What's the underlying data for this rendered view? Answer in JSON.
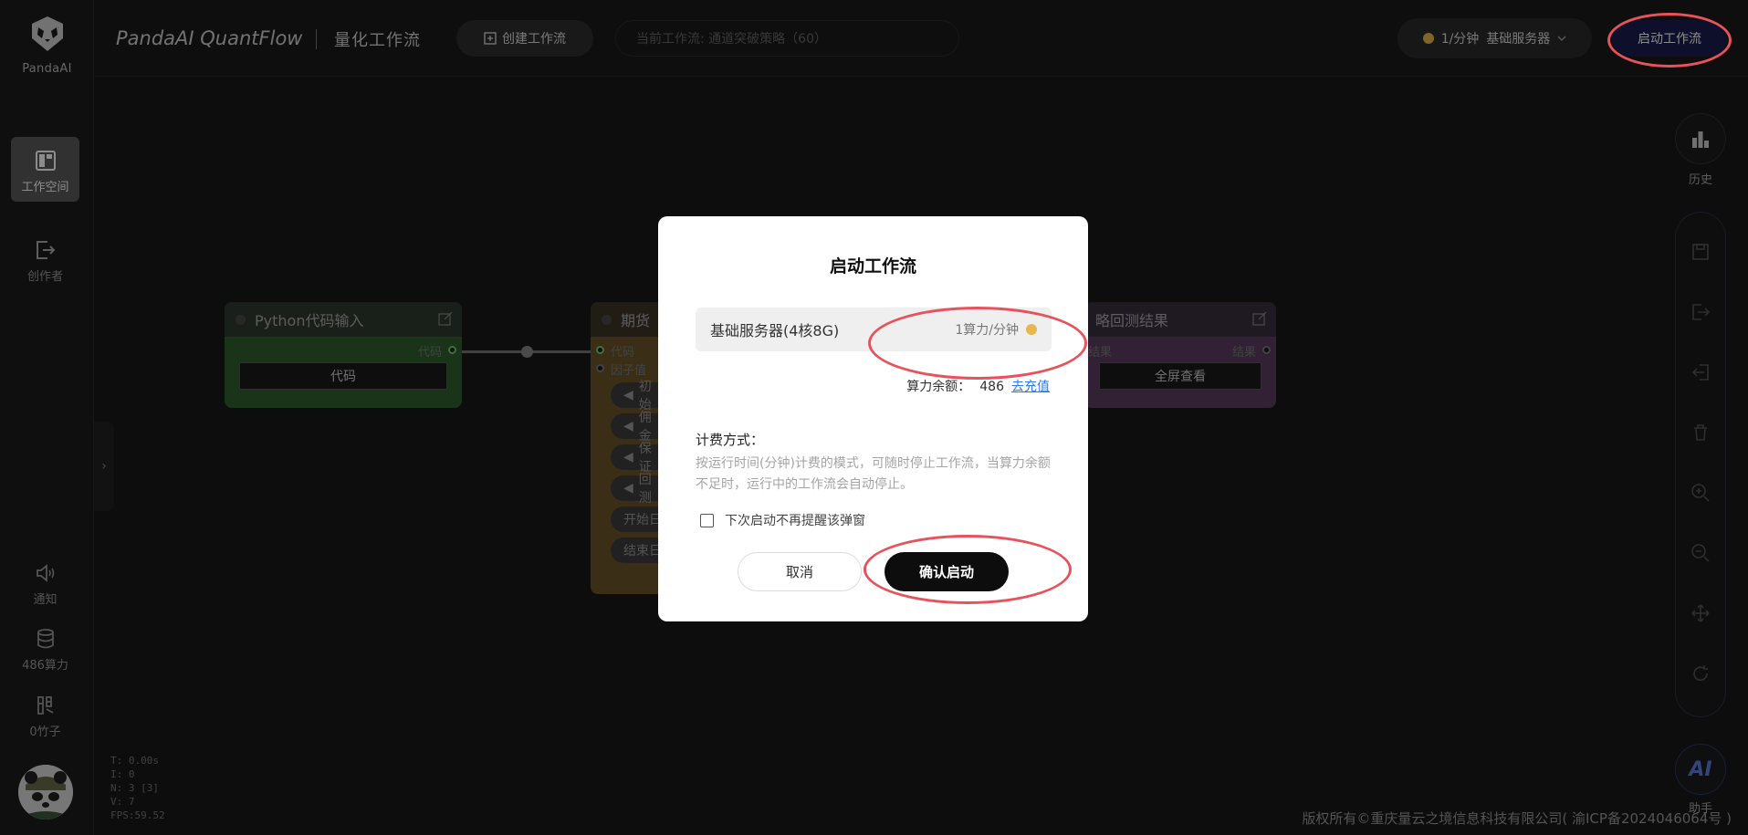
{
  "sidebar": {
    "logo_text": "PandaAI",
    "workspace": "工作空间",
    "creator": "创作者",
    "notify": "通知",
    "compute": "486算力",
    "bamboo": "0竹子"
  },
  "topbar": {
    "brand": "PandaAI QuantFlow",
    "brand_sub": "量化工作流",
    "create_label": "创建工作流",
    "current_flow": "当前工作流:  通道突破策略（60）",
    "server_rate": "1/分钟",
    "server_name": "基础服务器",
    "start_label": "启动工作流"
  },
  "nodes": {
    "python": {
      "title": "Python代码输入",
      "port_out": "代码",
      "button": "代码"
    },
    "futures": {
      "title": "期货",
      "port_code": "代码",
      "port_factor": "因子值",
      "params": [
        "初始",
        "佣金",
        "保证",
        "回测",
        "开始日",
        "结束日"
      ]
    },
    "result": {
      "title": "略回测结果",
      "port_in": "结果",
      "port_out": "结果",
      "button": "全屏查看"
    }
  },
  "stats": [
    "T: 0.00s",
    "I: 0",
    "N: 3 [3]",
    "V: 7",
    "FPS:59.52"
  ],
  "copyright": "版权所有©重庆量云之境信息科技有限公司( 渝ICP备2024046064号 )",
  "right_tools": {
    "history": "历史",
    "assistant_icon": "AI",
    "assistant": "助手"
  },
  "modal": {
    "title": "启动工作流",
    "server_name": "基础服务器(4核8G)",
    "server_rate": "1算力/分钟",
    "balance_label": "算力余额：",
    "balance_value": "486",
    "recharge": "去充值",
    "billing_label": "计费方式：",
    "billing_desc": "按运行时间(分钟)计费的模式，可随时停止工作流，当算力余额不足时，运行中的工作流会自动停止。",
    "remember": "下次启动不再提醒该弹窗",
    "cancel": "取消",
    "confirm": "确认启动"
  },
  "colors": {
    "accent_start": "#1b1d4f",
    "annotation_ring": "#e8525b",
    "link": "#2d7be5",
    "coin": "#e7b84b"
  }
}
